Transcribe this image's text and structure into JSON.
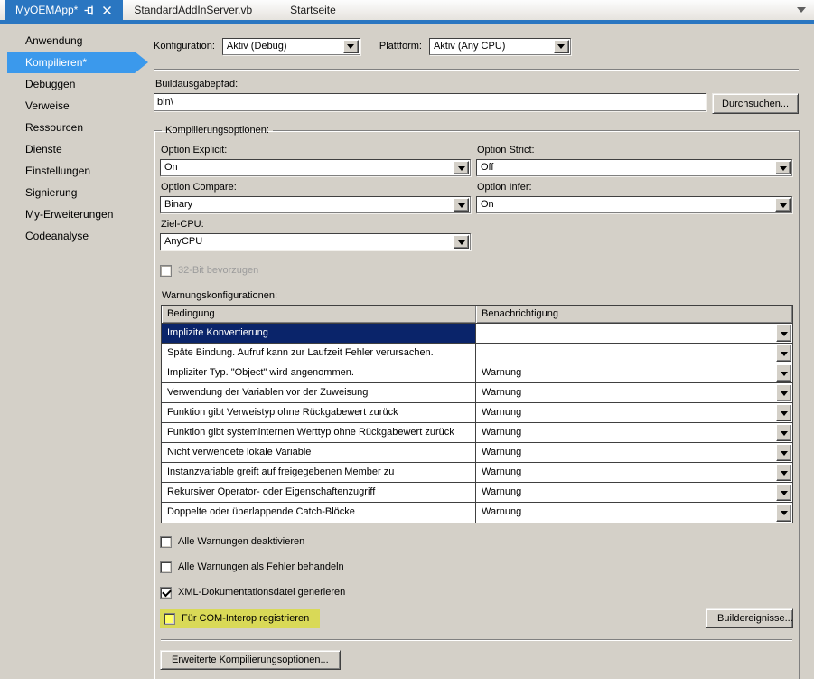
{
  "tabbar": {
    "tabs": [
      {
        "label": "MyOEMApp*"
      },
      {
        "label": "StandardAddInServer.vb"
      },
      {
        "label": "Startseite"
      }
    ]
  },
  "sidebar": {
    "items": [
      {
        "label": "Anwendung"
      },
      {
        "label": "Kompilieren*",
        "selected": true
      },
      {
        "label": "Debuggen"
      },
      {
        "label": "Verweise"
      },
      {
        "label": "Ressourcen"
      },
      {
        "label": "Dienste"
      },
      {
        "label": "Einstellungen"
      },
      {
        "label": "Signierung"
      },
      {
        "label": "My-Erweiterungen"
      },
      {
        "label": "Codeanalyse"
      }
    ]
  },
  "config_row": {
    "configuration_label": "Konfiguration:",
    "configuration_value": "Aktiv (Debug)",
    "platform_label": "Plattform:",
    "platform_value": "Aktiv (Any CPU)"
  },
  "build_output": {
    "label": "Buildausgabepfad:",
    "value": "bin\\",
    "browse_button": "Durchsuchen..."
  },
  "compile_options": {
    "group_label": "Kompilierungsoptionen:",
    "option_explicit": {
      "label": "Option Explicit:",
      "value": "On"
    },
    "option_strict": {
      "label": "Option Strict:",
      "value": "Off"
    },
    "option_compare": {
      "label": "Option Compare:",
      "value": "Binary"
    },
    "option_infer": {
      "label": "Option Infer:",
      "value": "On"
    },
    "target_cpu": {
      "label": "Ziel-CPU:",
      "value": "AnyCPU"
    },
    "prefer_32bit": {
      "label": "32-Bit bevorzugen",
      "checked": false,
      "disabled": true
    },
    "warning_configs": {
      "label": "Warnungskonfigurationen:",
      "columns": [
        "Bedingung",
        "Benachrichtigung"
      ],
      "rows": [
        {
          "condition": "Implizite Konvertierung",
          "notification": "",
          "selected": true
        },
        {
          "condition": "Späte Bindung. Aufruf kann zur Laufzeit Fehler verursachen.",
          "notification": ""
        },
        {
          "condition": "Impliziter Typ. \"Object\" wird angenommen.",
          "notification": "Warnung"
        },
        {
          "condition": "Verwendung der Variablen vor der Zuweisung",
          "notification": "Warnung"
        },
        {
          "condition": "Funktion gibt Verweistyp ohne Rückgabewert zurück",
          "notification": "Warnung"
        },
        {
          "condition": "Funktion gibt systeminternen Werttyp ohne Rückgabewert zurück",
          "notification": "Warnung"
        },
        {
          "condition": "Nicht verwendete lokale Variable",
          "notification": "Warnung"
        },
        {
          "condition": "Instanzvariable greift auf freigegebenen Member zu",
          "notification": "Warnung"
        },
        {
          "condition": "Rekursiver Operator- oder Eigenschaftenzugriff",
          "notification": "Warnung"
        },
        {
          "condition": "Doppelte oder überlappende Catch-Blöcke",
          "notification": "Warnung"
        }
      ]
    },
    "checkboxes": [
      {
        "label": "Alle Warnungen deaktivieren",
        "checked": false
      },
      {
        "label": "Alle Warnungen als Fehler behandeln",
        "checked": false
      },
      {
        "label": "XML-Dokumentationsdatei generieren",
        "checked": true
      },
      {
        "label": "Für COM-Interop registrieren",
        "checked": false,
        "highlighted": true
      }
    ],
    "build_events_button": "Buildereignisse...",
    "advanced_button": "Erweiterte Kompilierungsoptionen..."
  },
  "colors": {
    "window_background": "#d4d0c8",
    "active_tab_blue": "#2a76c1",
    "sidebar_selected_blue": "#3b99ec",
    "row_selection_navy": "#0a246a",
    "highlight_yellow": "#d9d957",
    "highlight_checkbox_yellow": "#ffff66"
  }
}
